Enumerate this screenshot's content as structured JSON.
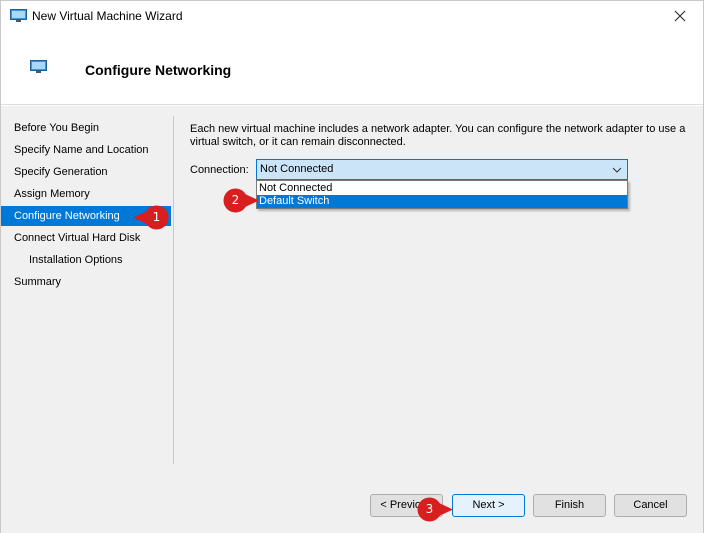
{
  "window": {
    "title": "New Virtual Machine Wizard"
  },
  "header": {
    "title": "Configure Networking"
  },
  "sidebar": {
    "items": [
      {
        "label": "Before You Begin"
      },
      {
        "label": "Specify Name and Location"
      },
      {
        "label": "Specify Generation"
      },
      {
        "label": "Assign Memory"
      },
      {
        "label": "Configure Networking"
      },
      {
        "label": "Connect Virtual Hard Disk"
      },
      {
        "label": "Installation Options"
      },
      {
        "label": "Summary"
      }
    ]
  },
  "main": {
    "description_line1": "Each new virtual machine includes a network adapter. You can configure the network adapter to use a",
    "description_line2": "virtual switch, or it can remain disconnected.",
    "connection_label": "Connection:",
    "connection_value": "Not Connected",
    "dropdown_options": [
      {
        "label": "Not Connected"
      },
      {
        "label": "Default Switch"
      }
    ]
  },
  "footer": {
    "previous_label": "< Previous",
    "next_label": "Next >",
    "finish_label": "Finish",
    "cancel_label": "Cancel"
  },
  "callouts": [
    {
      "number": "1"
    },
    {
      "number": "2"
    },
    {
      "number": "3"
    }
  ],
  "colors": {
    "accent": "#0078d7",
    "callout": "#d81e1e"
  }
}
